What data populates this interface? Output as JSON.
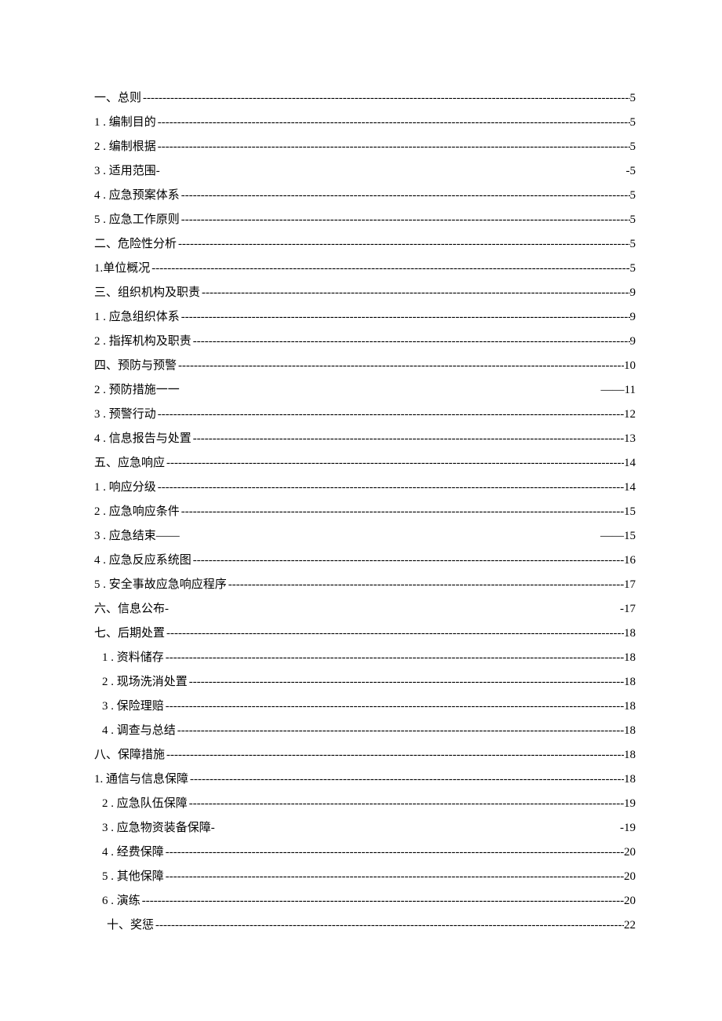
{
  "toc": [
    {
      "label": "一、总则 ",
      "page": "5",
      "leader": "dash",
      "indent": 1
    },
    {
      "label": "1  . 编制目的 ",
      "page": "5",
      "leader": "dash",
      "indent": 1
    },
    {
      "label": "2  . 编制根据 ",
      "page": "5",
      "leader": "dash",
      "indent": 1
    },
    {
      "label": "3  . 适用范围-",
      "page": "-5",
      "leader": "space",
      "indent": 1
    },
    {
      "label": "4  . 应急预案体系 ",
      "page": "5",
      "leader": "dash",
      "indent": 1
    },
    {
      "label": "5  . 应急工作原则 ",
      "page": "5",
      "leader": "dash",
      "indent": 1
    },
    {
      "label": "二、危险性分析 ",
      "page": "5",
      "leader": "dash",
      "indent": 1
    },
    {
      "label": "1.单位概况",
      "page": "5",
      "leader": "dash",
      "indent": 1
    },
    {
      "label": "三、组织机构及职责 ",
      "page": "9",
      "leader": "dash",
      "indent": 1
    },
    {
      "label": "1  . 应急组织体系 ",
      "page": "9",
      "leader": "dash",
      "indent": 1
    },
    {
      "label": "2  . 指挥机构及职责 ",
      "page": "9",
      "leader": "dash",
      "indent": 1
    },
    {
      "label": "四、预防与预警 ",
      "page": "10",
      "leader": "dash",
      "indent": 1
    },
    {
      "label": "2  . 预防措施一一",
      "page": "——11",
      "leader": "space",
      "indent": 1
    },
    {
      "label": "3  . 预警行动",
      "page": "12",
      "leader": "dash",
      "indent": 1
    },
    {
      "label": "4  . 信息报告与处置",
      "page": "13",
      "leader": "dash",
      "indent": 1
    },
    {
      "label": "五、应急响应 ",
      "page": "14",
      "leader": "dash",
      "indent": 1
    },
    {
      "label": "1  . 响应分级 ",
      "page": "14",
      "leader": "dash",
      "indent": 1
    },
    {
      "label": "2  . 应急响应条件 ",
      "page": "15",
      "leader": "dash",
      "indent": 1
    },
    {
      "label": "3  .  应急结束——",
      "page": "——15",
      "leader": "space",
      "indent": 1
    },
    {
      "label": "4  . 应急反应系统图 ",
      "page": "16",
      "leader": "dash",
      "indent": 1
    },
    {
      "label": "5  . 安全事故应急响应程序 ",
      "page": "17",
      "leader": "dash",
      "indent": 1
    },
    {
      "label": "六、信息公布-",
      "page": "-17",
      "leader": "space",
      "indent": 1
    },
    {
      "label": "七、后期处置 ",
      "page": "18",
      "leader": "dash",
      "indent": 1
    },
    {
      "label": "1  . 资料储存 ",
      "page": "18",
      "leader": "dash",
      "indent": 2
    },
    {
      "label": "2  . 现场洗消处置 ",
      "page": "18",
      "leader": "dash",
      "indent": 2
    },
    {
      "label": "3   .  保险理赔 ",
      "page": "18",
      "leader": "dash",
      "indent": 2
    },
    {
      "label": "4   .  调查与总结 ",
      "page": "18",
      "leader": "dash",
      "indent": 2
    },
    {
      "label": "八、保障措施 ",
      "page": "18",
      "leader": "dash",
      "indent": 1
    },
    {
      "label": "1. 通信与信息保障 ",
      "page": "18",
      "leader": "dash",
      "indent": 1
    },
    {
      "label": "2  . 应急队伍保障 ",
      "page": "19",
      "leader": "dash",
      "indent": 2
    },
    {
      "label": "3   .  应急物资装备保障-",
      "page": "-19",
      "leader": "space",
      "indent": 2
    },
    {
      "label": "4   .  经费保障 ",
      "page": "20",
      "leader": "dash",
      "indent": 2
    },
    {
      "label": "5   .  其他保障",
      "page": "20",
      "leader": "dash",
      "indent": 2
    },
    {
      "label": "6  . 演练 ",
      "page": "20",
      "leader": "dash",
      "indent": 2
    },
    {
      "label": "十、奖惩 ",
      "page": "22",
      "leader": "dash",
      "indent": 3
    }
  ]
}
